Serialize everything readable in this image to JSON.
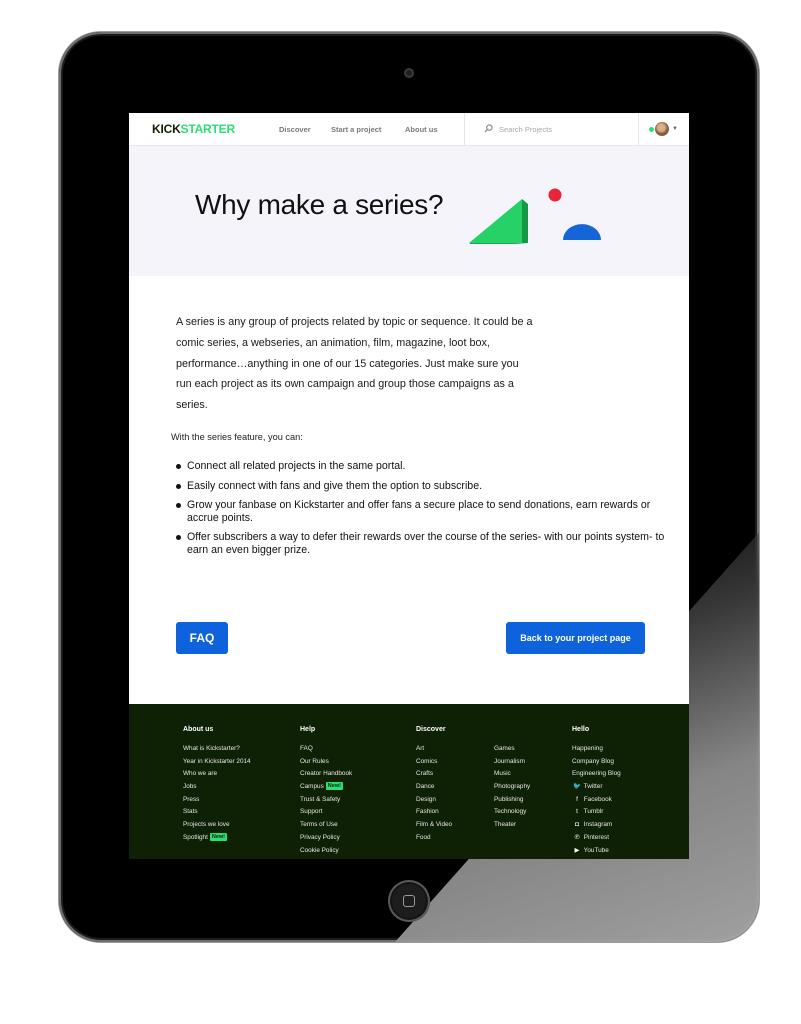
{
  "nav": {
    "logo_part1": "KICK",
    "logo_part2": "STARTER",
    "links": [
      "Discover",
      "Start a project",
      "About us"
    ],
    "search_placeholder": "Search Projects",
    "search_icon": "search-icon",
    "avatar_icon": "avatar",
    "menu_icon": "chevron-down-icon"
  },
  "hero": {
    "title": "Why make a series?"
  },
  "content": {
    "intro": "A series is any group of projects related by topic or sequence.  It could be a comic series, a webseries, an animation, film, magazine, loot box, performance…anything in one of our 15 categories. Just make sure you run each project as its own campaign and group those campaigns as a series.",
    "features_lead": "With the series feature, you can:",
    "features": [
      "Connect all related projects in the same portal.",
      "Easily connect with fans and give them the option to subscribe.",
      "Grow your fanbase on Kickstarter and offer fans a secure place to send donations, earn rewards or accrue points.",
      "Offer subscribers a way to defer their rewards over the course of the series- with our points system- to earn an even bigger prize."
    ],
    "faq_button": "FAQ",
    "back_button": "Back to your project page"
  },
  "footer": {
    "about": {
      "heading": "About us",
      "items": [
        "What is Kickstarter?",
        "Year in Kickstarter 2014",
        "Who we are",
        "Jobs",
        "Press",
        "Stats",
        "Projects we love",
        "Spotlight"
      ],
      "spotlight_badge": "New!"
    },
    "help": {
      "heading": "Help",
      "items": [
        "FAQ",
        "Our Rules",
        "Creator Handbook",
        "Campus",
        "Trust & Safety",
        "Support",
        "Terms of Use",
        "Privacy Policy",
        "Cookie Policy"
      ],
      "campus_badge": "New!"
    },
    "discover": {
      "heading": "Discover",
      "col1": [
        "Art",
        "Comics",
        "Crafts",
        "Dance",
        "Design",
        "Fashion",
        "Film & Video",
        "Food"
      ],
      "col2": [
        "Games",
        "Journalism",
        "Music",
        "Photography",
        "Publishing",
        "Technology",
        "Theater"
      ]
    },
    "hello": {
      "heading": "Hello",
      "items": [
        "Happening",
        "Company Blog",
        "Engineering Blog"
      ],
      "social": [
        {
          "label": "Twitter",
          "icon": "twitter-icon",
          "glyph": "🐦"
        },
        {
          "label": "Facebook",
          "icon": "facebook-icon",
          "glyph": "f"
        },
        {
          "label": "Tumblr",
          "icon": "tumblr-icon",
          "glyph": "t"
        },
        {
          "label": "Instagram",
          "icon": "instagram-icon",
          "glyph": "◘"
        },
        {
          "label": "Pinterest",
          "icon": "pinterest-icon",
          "glyph": "℗"
        },
        {
          "label": "YouTube",
          "icon": "youtube-icon",
          "glyph": "▶"
        }
      ]
    }
  },
  "colors": {
    "brand_green": "#2bde73",
    "brand_dark": "#0f2105",
    "button_blue": "#0e63dc",
    "hero_bg": "#f6f4fb",
    "art_red": "#e8243a",
    "art_blue": "#1565d8"
  }
}
